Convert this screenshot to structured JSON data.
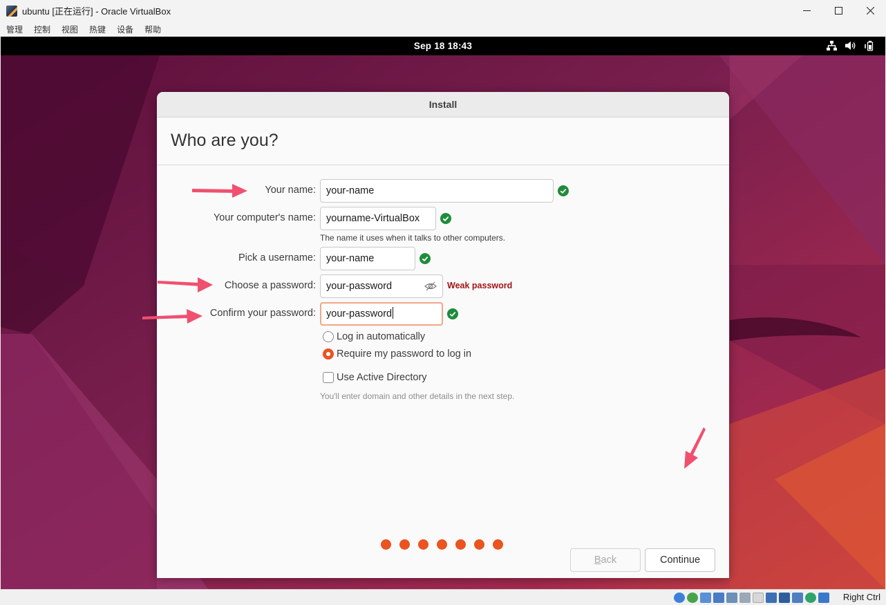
{
  "window": {
    "title": "ubuntu [正在运行] - Oracle VirtualBox",
    "controls": {
      "minimize": "—",
      "maximize": "☐",
      "close": "✕"
    }
  },
  "menubar": {
    "items": [
      {
        "label": "管理"
      },
      {
        "label": "控制"
      },
      {
        "label": "视图"
      },
      {
        "label": "热键"
      },
      {
        "label": "设备"
      },
      {
        "label": "帮助"
      }
    ]
  },
  "guest": {
    "clock": "Sep 18  18:43",
    "tray": [
      "network-icon",
      "volume-icon",
      "battery-icon"
    ]
  },
  "installer": {
    "window_title": "Install",
    "heading": "Who are you?",
    "fields": {
      "your_name": {
        "label": "Your name:",
        "value": "your-name",
        "valid": true
      },
      "computer_name": {
        "label": "Your computer's name:",
        "value": "yourname-VirtualBox",
        "hint": "The name it uses when it talks to other computers.",
        "valid": true
      },
      "username": {
        "label": "Pick a username:",
        "value": "your-name",
        "valid": true
      },
      "password": {
        "label": "Choose a password:",
        "value": "your-password",
        "strength": "Weak password"
      },
      "confirm_password": {
        "label": "Confirm your password:",
        "value": "your-password",
        "valid": true,
        "focused": true
      }
    },
    "login_options": [
      {
        "label": "Log in automatically",
        "selected": false
      },
      {
        "label": "Require my password to log in",
        "selected": true
      }
    ],
    "active_directory": {
      "label": "Use Active Directory",
      "checked": false,
      "hint": "You'll enter domain and other details in the next step."
    },
    "buttons": {
      "back_prefix": "",
      "back_mnemonic": "B",
      "back_rest": "ack",
      "continue": "Continue"
    },
    "progress_dots": 7
  },
  "statusbar": {
    "host_key": "Right Ctrl"
  },
  "colors": {
    "ubuntu_orange": "#e95420",
    "valid_green": "#1e8c3a",
    "weak_red": "#a31515",
    "annotation_arrow": "#f0506e"
  }
}
